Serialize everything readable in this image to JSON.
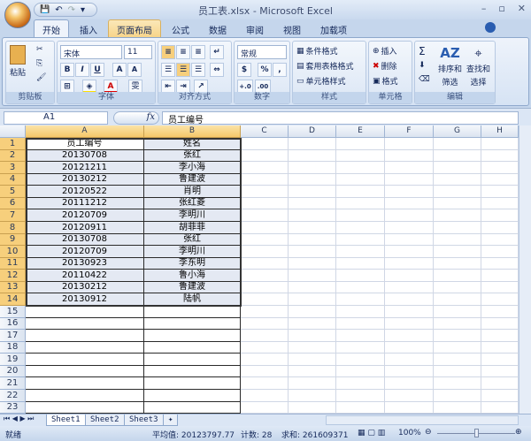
{
  "window": {
    "title": "员工表.xlsx - Microsoft Excel",
    "minimize": "–",
    "maximize": "▫",
    "close": "✕"
  },
  "qat": {
    "save": "💾",
    "undo": "↶",
    "redo": "↷",
    "more": "▾"
  },
  "tabs": [
    "开始",
    "插入",
    "页面布局",
    "公式",
    "数据",
    "审阅",
    "视图",
    "加载项"
  ],
  "ribbon": {
    "clipboard": {
      "label": "剪贴板",
      "paste": "粘贴"
    },
    "font": {
      "label": "字体",
      "name": "宋体",
      "size": "11",
      "bold": "B",
      "italic": "I",
      "underline": "U",
      "grow": "A",
      "shrink": "A",
      "phonetic": "雯"
    },
    "alignment": {
      "label": "对齐方式"
    },
    "number": {
      "label": "数字",
      "format": "常规",
      "percent": "%",
      "comma": ",",
      "inc": "+.0",
      "dec": ".00"
    },
    "styles": {
      "label": "样式",
      "conditional": "条件格式",
      "table": "套用表格格式",
      "cell": "单元格样式"
    },
    "cells": {
      "label": "单元格",
      "insert": "插入",
      "delete": "删除",
      "format": "格式"
    },
    "editing": {
      "label": "编辑",
      "sum": "Σ",
      "sort": "排序和",
      "sort2": "筛选",
      "find": "查找和",
      "find2": "选择"
    }
  },
  "formula_bar": {
    "name_box": "A1",
    "fx": "fx",
    "value": "员工编号"
  },
  "columns": [
    "A",
    "B",
    "C",
    "D",
    "E",
    "F",
    "G",
    "H"
  ],
  "rows": [
    [
      "员工编号",
      "姓名"
    ],
    [
      "20130708",
      "张红"
    ],
    [
      "20121211",
      "李小海"
    ],
    [
      "20130212",
      "鲁建波"
    ],
    [
      "20120522",
      "肖明"
    ],
    [
      "20111212",
      "张红菱"
    ],
    [
      "20120709",
      "李明川"
    ],
    [
      "20120911",
      "胡菲菲"
    ],
    [
      "20130708",
      "张红"
    ],
    [
      "20120709",
      "李明川"
    ],
    [
      "20130923",
      "李东明"
    ],
    [
      "20110422",
      "鲁小海"
    ],
    [
      "20130212",
      "鲁建波"
    ],
    [
      "20130912",
      "陆帆"
    ]
  ],
  "total_rows": 23,
  "sheets": [
    "Sheet1",
    "Sheet2",
    "Sheet3"
  ],
  "status": {
    "ready": "就绪",
    "average": "平均值: 20123797.77",
    "count": "计数: 28",
    "sum": "求和: 261609371",
    "zoom": "100%"
  }
}
